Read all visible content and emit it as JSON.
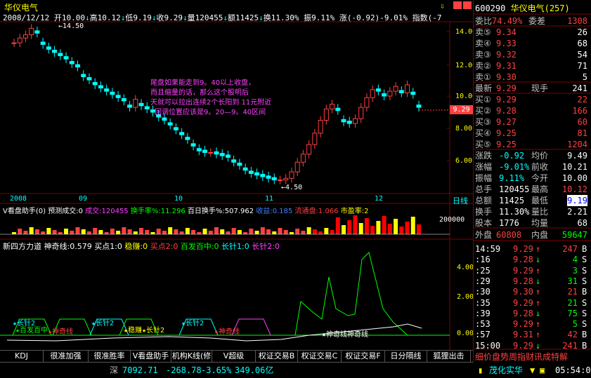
{
  "title": "华仪电气",
  "info_line": {
    "date": "2008/12/12",
    "open": "开10.00",
    "high": "高10.12",
    "low": "低9.19",
    "close": "收9.29",
    "volume": "量120455",
    "amount": "额11425",
    "turnover": "换11.30%",
    "amplitude": "振9.11%",
    "change": "涨(-0.92)-9.01%",
    "index": "指数(-7"
  },
  "price_axis": [
    "14.00",
    "12.00",
    "10.00",
    "8.00",
    "6.00"
  ],
  "current_price_tag": "9.29",
  "high_label": "14.50",
  "low_label": "4.50",
  "date_axis": [
    "2008",
    "09",
    "10",
    "11",
    "12"
  ],
  "period_label": "日线",
  "annotation": {
    "line1": "尾盘如果能走到9。40以上收盘，",
    "line2": "而且缩量的话，那么这个股明后",
    "line3": "天就可以拉出连续2个长阳到 11元附近",
    "line4": "回调位置应该是9。20—9。40区间"
  },
  "vol_panel": {
    "name": "V看盘助手(0)",
    "pred": "预测成交:0",
    "deal": "成交:120455",
    "turnover_rate": "换手率%:11.296",
    "baibai": "百日换手%:507.962",
    "profit": "收益:0.185",
    "float": "流通盘:1.066",
    "pe": "市盈率:2",
    "axis": "200000"
  },
  "ind_panel": {
    "name": "新四方力道",
    "shenqi": "神奇线:0.579",
    "buy": "买点1:0",
    "wen": "稳赚:0",
    "buy2": "买点2:0",
    "baifa": "百发百中:0",
    "changzhen1": "长针1:0",
    "changzhen2": "长针2:0",
    "axis": [
      "4.00",
      "2.00",
      "0.00"
    ],
    "labels": {
      "l1": "★长针2",
      "l2": "★长针2",
      "l3": "★长针2",
      "l4": "★稳赚★长针2",
      "l5": "★百发百中",
      "l6": "★神奇线",
      "l7": "★神奇线",
      "l8": "★神奇线神奇线"
    }
  },
  "toolbar": {
    "buttons": [
      "KDJ",
      "很准加强",
      "很准胜率",
      "V看盘助手",
      "机构K线(修",
      "V超级MACD",
      "权证交易B",
      "权证交易C",
      "权证交易F",
      "日分隔线",
      "狐狸出击"
    ]
  },
  "statusbar": {
    "market": "深",
    "index": "7092.71",
    "change": "-268.78",
    "pct": "-3.65%",
    "amount": "349.06亿",
    "broker": "茂化实华",
    "time": "05:54:05"
  },
  "quote": {
    "code": "600290",
    "name": "华仪电气",
    "num": "(257)",
    "weibi_label": "委比",
    "weibi": "74.49%",
    "weicha_label": "委差",
    "weicha": "1308",
    "sells": [
      {
        "label": "卖⑤",
        "price": "9.34",
        "vol": "26"
      },
      {
        "label": "卖④",
        "price": "9.33",
        "vol": "68"
      },
      {
        "label": "卖③",
        "price": "9.32",
        "vol": "54"
      },
      {
        "label": "卖②",
        "price": "9.31",
        "vol": "71"
      },
      {
        "label": "卖①",
        "price": "9.30",
        "vol": "5"
      }
    ],
    "latest_label": "最新",
    "latest": "9.29",
    "xianshou_label": "现手",
    "xianshou": "241",
    "buys": [
      {
        "label": "买①",
        "price": "9.29",
        "vol": "22"
      },
      {
        "label": "买②",
        "price": "9.28",
        "vol": "166"
      },
      {
        "label": "买③",
        "price": "9.27",
        "vol": "60"
      },
      {
        "label": "买④",
        "price": "9.25",
        "vol": "81"
      },
      {
        "label": "买⑤",
        "price": "9.25",
        "vol": "1204"
      }
    ],
    "stats": [
      {
        "l1": "涨跌",
        "v1": "-0.92",
        "l2": "均价",
        "v2": "9.49"
      },
      {
        "l1": "涨幅",
        "v1": "-9.01%",
        "l2": "前收",
        "v2": "10.21"
      },
      {
        "l1": "振幅",
        "v1": "9.11%",
        "l2": "今开",
        "v2": "10.00"
      },
      {
        "l1": "总手",
        "v1": "120455",
        "l2": "最高",
        "v2": "10.12"
      },
      {
        "l1": "总额",
        "v1": "11425",
        "l2": "最低",
        "v2": "9.19"
      },
      {
        "l1": "换手",
        "v1": "11.30%",
        "l2": "量比",
        "v2": "2.21"
      },
      {
        "l1": "股本",
        "v1": "1776",
        "l2": "均量",
        "v2": "68"
      }
    ],
    "waipan_label": "外盘",
    "waipan": "60808",
    "neipan_label": "内盘",
    "neipan": "59647",
    "ticks": [
      {
        "t": "14:59",
        "p": "9.29",
        "arrow": "↑",
        "v": "247",
        "s": "B",
        "pc": "red",
        "vc": "red"
      },
      {
        "t": ":16",
        "p": "9.28",
        "arrow": "↓",
        "v": "4",
        "s": "S",
        "pc": "red",
        "vc": "green"
      },
      {
        "t": ":25",
        "p": "9.29",
        "arrow": "↑",
        "v": "3",
        "s": "S",
        "pc": "red",
        "vc": "green"
      },
      {
        "t": ":29",
        "p": "9.28",
        "arrow": "↓",
        "v": "31",
        "s": "S",
        "pc": "red",
        "vc": "green"
      },
      {
        "t": ":30",
        "p": "9.30",
        "arrow": "↑",
        "v": "21",
        "s": "B",
        "pc": "red",
        "vc": "red"
      },
      {
        "t": ":35",
        "p": "9.29",
        "arrow": "↑",
        "v": "21",
        "s": "S",
        "pc": "red",
        "vc": "green"
      },
      {
        "t": ":39",
        "p": "9.28",
        "arrow": "↓",
        "v": "75",
        "s": "S",
        "pc": "red",
        "vc": "green"
      },
      {
        "t": ":53",
        "p": "9.29",
        "arrow": "↑",
        "v": "5",
        "s": "S",
        "pc": "red",
        "vc": "green"
      },
      {
        "t": ":57",
        "p": "9.31",
        "arrow": "↑",
        "v": "42",
        "s": "B",
        "pc": "red",
        "vc": "red"
      },
      {
        "t": "15:00",
        "p": "9.29",
        "arrow": "↓",
        "v": "241",
        "s": "B",
        "pc": "red",
        "vc": "red"
      }
    ],
    "bottom_tabs": "细价盘势周指财讯成特解"
  },
  "colors": {
    "up": "#ff4040",
    "down": "#00ffff",
    "grid": "#800000",
    "accent": "#ffff00"
  }
}
